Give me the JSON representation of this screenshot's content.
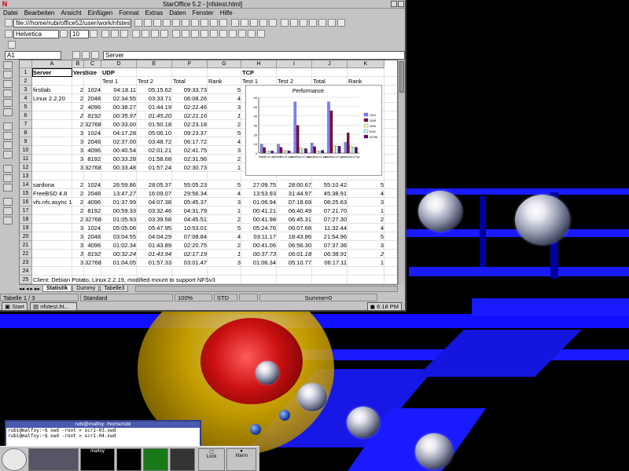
{
  "window": {
    "title": "StarOffice 5.2 - [nfstest.html]"
  },
  "menu": [
    "Datei",
    "Bearbeiten",
    "Ansicht",
    "Einfügen",
    "Format",
    "Extras",
    "Daten",
    "Fenster",
    "Hilfe"
  ],
  "toolbar": {
    "url": "file:///home/rubi/office52/user/work/nfstest",
    "font": "Helvetica",
    "size": "10"
  },
  "formula": {
    "cellref": "A1",
    "content": "Server"
  },
  "sheet": {
    "columns": [
      "A",
      "B",
      "C",
      "D",
      "E",
      "F",
      "G",
      "H",
      "I",
      "J",
      "K"
    ],
    "rows": [
      [
        "Server",
        "Vers",
        "Size",
        "UDP",
        "",
        "",
        "",
        "TCP",
        "",
        "",
        ""
      ],
      [
        "",
        "",
        "",
        "Test 1",
        "Test 2",
        "Total",
        "Rank",
        "Test 1",
        "Test 2",
        "Total",
        "Rank"
      ],
      [
        "firstlab",
        "2",
        "1024",
        "04:18.11",
        "05:15.62",
        "09:33.73",
        "5",
        "",
        "",
        "",
        ""
      ],
      [
        "Linux 2.2.20",
        "2",
        "2048",
        "02:34.55",
        "03:33.71",
        "06:08.26",
        "4",
        "",
        "",
        "",
        ""
      ],
      [
        "",
        "2",
        "4096",
        "00:38.27",
        "01:44.19",
        "02:22.46",
        "3",
        "",
        "",
        "",
        ""
      ],
      [
        "",
        "2",
        "8192",
        "00:35.97",
        "01:45.20",
        "02:21.16",
        "1",
        "",
        "",
        "",
        ""
      ],
      [
        "",
        "2",
        "32768",
        "00:33.00",
        "01:50.18",
        "02:23.18",
        "2",
        "",
        "",
        "",
        ""
      ],
      [
        "",
        "3",
        "1024",
        "04:17.28",
        "05:06.10",
        "09:23.37",
        "5",
        "",
        "",
        "",
        ""
      ],
      [
        "",
        "3",
        "2048",
        "02:37.00",
        "03:48.72",
        "06:17.72",
        "4",
        "",
        "",
        "",
        ""
      ],
      [
        "",
        "3",
        "4096",
        "00:40.54",
        "02:01.21",
        "02:41.75",
        "3",
        "",
        "",
        "",
        ""
      ],
      [
        "",
        "3",
        "8192",
        "00:33.28",
        "01:58.68",
        "02:31.96",
        "2",
        "",
        "",
        "",
        ""
      ],
      [
        "",
        "3",
        "32768",
        "00:33.48",
        "01:57.24",
        "02:30.73",
        "1",
        "",
        "",
        "",
        ""
      ],
      [
        "",
        "",
        "",
        "",
        "",
        "",
        "",
        "",
        "",
        "",
        ""
      ],
      [
        "sardona",
        "2",
        "1024",
        "26:59.86",
        "28:05.37",
        "55:05.23",
        "5",
        "27:09.75",
        "28:00.67",
        "55:10.42",
        "5"
      ],
      [
        "FreeBSD 4.8",
        "2",
        "2048",
        "13:47.27",
        "16:09.07",
        "29:56.34",
        "4",
        "13:53.93",
        "31:44.97",
        "45:38.91",
        "4"
      ],
      [
        "vfs.nfs.async 1",
        "2",
        "4096",
        "01:37.99",
        "04:07.38",
        "05:45.37",
        "3",
        "01:06.94",
        "07:18.69",
        "08:25.63",
        "3"
      ],
      [
        "",
        "2",
        "8192",
        "00:59.33",
        "03:32.46",
        "04:31.79",
        "1",
        "00:41.21",
        "06:40.49",
        "07:21.70",
        "1"
      ],
      [
        "",
        "2",
        "32768",
        "01:05.93",
        "03:39.58",
        "04:45.51",
        "2",
        "00:41.98",
        "06:45.31",
        "07:27.30",
        "2"
      ],
      [
        "",
        "3",
        "1024",
        "05:05.06",
        "05:47.95",
        "10:53.01",
        "5",
        "05:24.76",
        "06:07.68",
        "11:32.44",
        "4"
      ],
      [
        "",
        "3",
        "2048",
        "03:04.55",
        "04:04.29",
        "07:08.84",
        "4",
        "03:11.17",
        "18:43.86",
        "21:54.96",
        "5"
      ],
      [
        "",
        "3",
        "4096",
        "01:02.34",
        "01:43.89",
        "02:20.75",
        "2",
        "00:41.06",
        "06:56.30",
        "07:37.36",
        "3"
      ],
      [
        "",
        "3",
        "8192",
        "00:32.24",
        "01:43.94",
        "02:17.19",
        "1",
        "00:37.73",
        "06:01.18",
        "06:38.91",
        "2"
      ],
      [
        "",
        "3",
        "32768",
        "01:04.05",
        "01:57.33",
        "03:01.47",
        "3",
        "01:06.34",
        "05:10.77",
        "06:17.11",
        "1"
      ],
      [
        "",
        "",
        "",
        "",
        "",
        "",
        "",
        "",
        "",
        "",
        ""
      ],
      [
        "Client: Debian Potato, Linux 2.2.19, modified mount to support NFSv3",
        "",
        "",
        "",
        "",
        "",
        "",
        "",
        "",
        "",
        ""
      ]
    ]
  },
  "chart_data": {
    "type": "bar",
    "title": "Performance",
    "categories": [
      "firstlab-v2 udp",
      "firstlab-v3 udp",
      "sardona-v2 udp",
      "sardona-v3 udp",
      "sardona-v2 tcp",
      "sardona-v3 tcp"
    ],
    "series": [
      {
        "name": "1024",
        "values": [
          9.6,
          9.4,
          55.1,
          10.9,
          55.2,
          11.5
        ]
      },
      {
        "name": "2048",
        "values": [
          6.1,
          6.3,
          29.9,
          7.1,
          45.6,
          21.9
        ]
      },
      {
        "name": "4096",
        "values": [
          2.4,
          2.7,
          5.8,
          2.3,
          8.4,
          7.6
        ]
      },
      {
        "name": "8192",
        "values": [
          2.4,
          2.5,
          4.5,
          2.3,
          7.4,
          6.6
        ]
      },
      {
        "name": "32768",
        "values": [
          2.4,
          2.5,
          4.8,
          3.0,
          7.5,
          6.3
        ]
      }
    ],
    "ylim": [
      0,
      60
    ],
    "ytick_step": 10,
    "colors": [
      "#8080ff",
      "#800040",
      "#ffffc0",
      "#c0ffff",
      "#600080"
    ]
  },
  "tabs": {
    "active": "Statistik",
    "others": [
      "Dummy",
      "Tabelle3"
    ]
  },
  "status": {
    "sheet": "Tabelle 1 / 3",
    "style": "Standard",
    "zoom": "100%",
    "mode": "STD",
    "sum": "Summe=0"
  },
  "taskbar": {
    "start": "Start",
    "task": "nfstest.ht...",
    "time": "6:18 PM"
  },
  "xterm": {
    "title": "rubi@malfoy: /home/rubi",
    "lines": [
      "rubi@malfoy:~$ xwd -root > scr1-03.xwd",
      "rubi@malfoy:~$ xwd -root > scr1-04.xwd"
    ]
  },
  "panel": {
    "host": "malfoy",
    "lock": "Lock",
    "xterm": "Xterm"
  }
}
